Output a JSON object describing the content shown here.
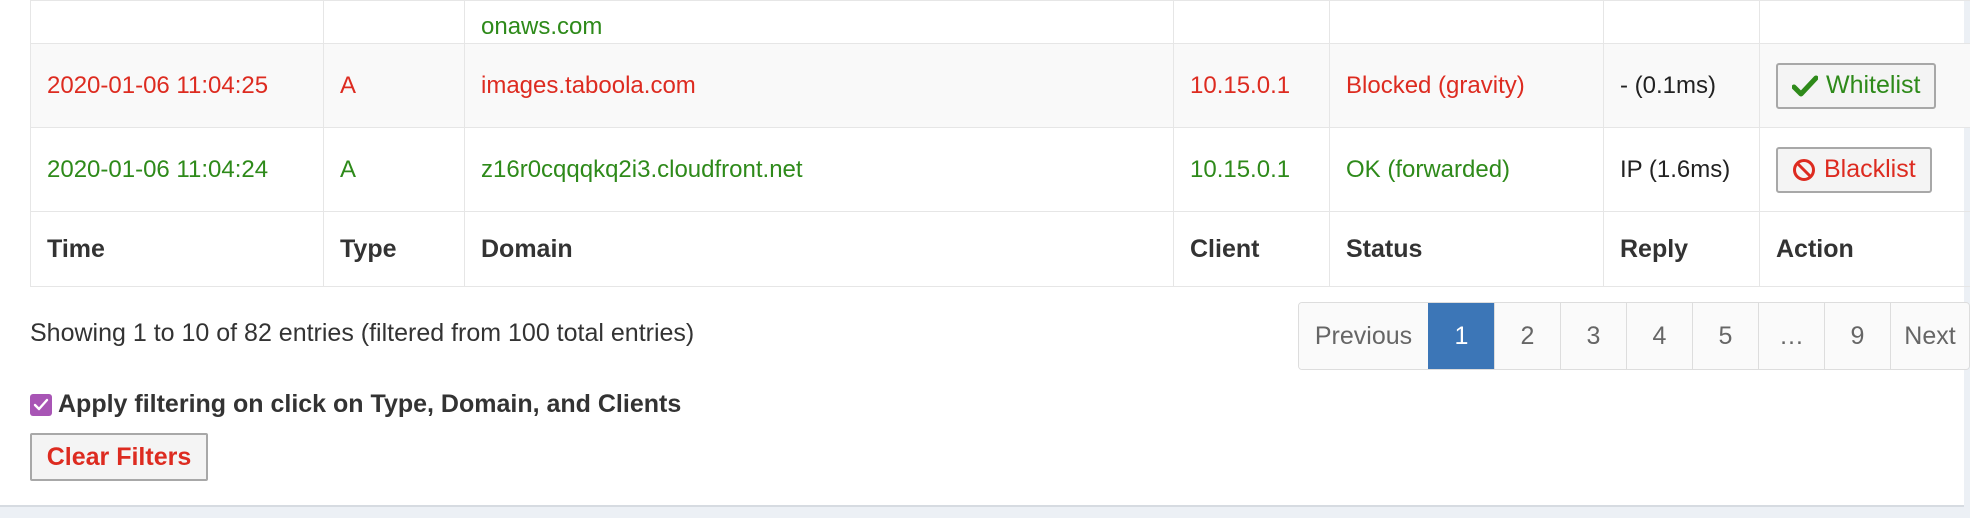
{
  "table": {
    "partial_row": {
      "domain": "onaws.com"
    },
    "rows": [
      {
        "time": "2020-01-06 11:04:25",
        "type": "A",
        "domain": "images.taboola.com",
        "client": "10.15.0.1",
        "status": "Blocked (gravity)",
        "reply": "- (0.1ms)",
        "action_label": "Whitelist",
        "action_icon": "check-icon",
        "status_color": "#dd2b20"
      },
      {
        "time": "2020-01-06 11:04:24",
        "type": "A",
        "domain": "z16r0cqqqkq2i3.cloudfront.net",
        "client": "10.15.0.1",
        "status": "OK (forwarded)",
        "reply": "IP (1.6ms)",
        "action_label": "Blacklist",
        "action_icon": "ban-icon",
        "status_color": "#2e8a1a"
      }
    ],
    "columns": [
      "Time",
      "Type",
      "Domain",
      "Client",
      "Status",
      "Reply",
      "Action"
    ]
  },
  "info_text": "Showing 1 to 10 of 82 entries (filtered from 100 total entries)",
  "pagination": {
    "previous": "Previous",
    "pages": [
      "1",
      "2",
      "3",
      "4",
      "5",
      "…",
      "9"
    ],
    "active": "1",
    "next": "Next"
  },
  "filter_label": "Apply filtering on click on Type, Domain, and Clients",
  "filter_checked": true,
  "clear_filters_label": "Clear Filters",
  "colors": {
    "blocked": "#dd2b20",
    "ok": "#2e8a1a",
    "active_page": "#3c76b7",
    "checkbox": "#a855b5"
  }
}
